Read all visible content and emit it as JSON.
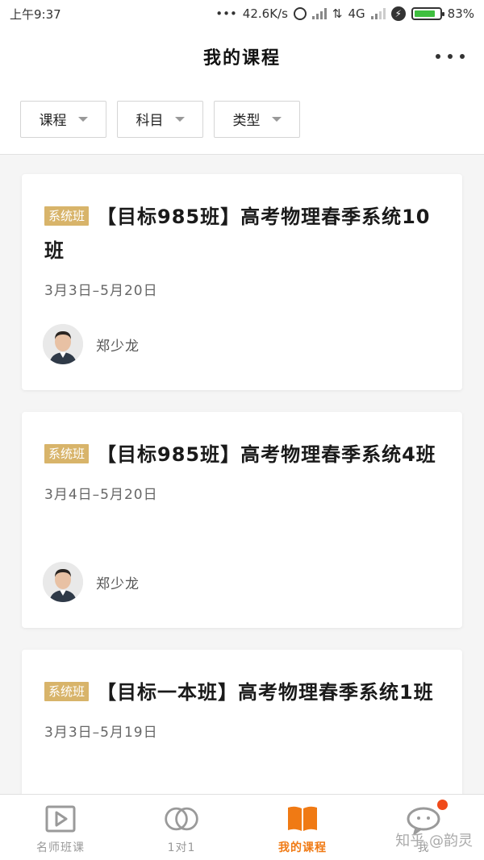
{
  "status_bar": {
    "time": "上午9:37",
    "net_speed": "42.6K/s",
    "network": "4G",
    "battery": "83%",
    "battery_level": 0.83
  },
  "header": {
    "title": "我的课程"
  },
  "filters": [
    {
      "label": "课程"
    },
    {
      "label": "科目"
    },
    {
      "label": "类型"
    }
  ],
  "courses": [
    {
      "tag": "系统班",
      "title": "【目标985班】高考物理春季系统10班",
      "date": "3月3日–5月20日",
      "teacher": "郑少龙"
    },
    {
      "tag": "系统班",
      "title": "【目标985班】高考物理春季系统4班",
      "date": "3月4日–5月20日",
      "teacher": "郑少龙"
    },
    {
      "tag": "系统班",
      "title": "【目标一本班】高考物理春季系统1班",
      "date": "3月3日–5月19日",
      "teacher": ""
    }
  ],
  "bottom_nav": [
    {
      "label": "名师班课",
      "icon": "play-icon",
      "active": false
    },
    {
      "label": "1对1",
      "icon": "one-on-one-icon",
      "active": false
    },
    {
      "label": "我的课程",
      "icon": "book-icon",
      "active": true
    },
    {
      "label": "我",
      "icon": "profile-icon",
      "active": false
    }
  ],
  "watermark": "知乎 @韵灵",
  "colors": {
    "accent": "#f07a14",
    "tag": "#d8b46a",
    "notify": "#f04a1a"
  }
}
